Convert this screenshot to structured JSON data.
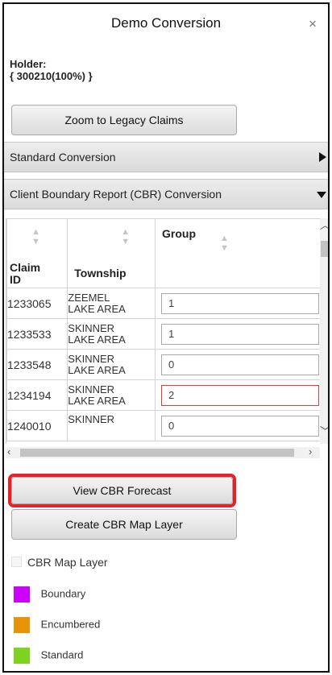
{
  "dialog": {
    "title": "Demo Conversion",
    "close_icon": "×"
  },
  "holder": {
    "label": "Holder:",
    "value": "{ 300210(100%) }"
  },
  "buttons": {
    "zoom_legacy": "Zoom to Legacy Claims",
    "view_cbr": "View CBR Forecast",
    "create_cbr_layer": "Create CBR Map Layer"
  },
  "accordion": {
    "standard": "Standard Conversion",
    "cbr": "Client Boundary Report (CBR) Conversion"
  },
  "table": {
    "headers": {
      "claim_id_line1": "Claim",
      "claim_id_line2": "ID",
      "township": "Township",
      "group": "Group"
    },
    "rows": [
      {
        "claim_id": "1233065",
        "township_line1": "ZEEMEL",
        "township_line2": "LAKE AREA",
        "group": "1"
      },
      {
        "claim_id": "1233533",
        "township_line1": "SKINNER",
        "township_line2": "LAKE AREA",
        "group": "1"
      },
      {
        "claim_id": "1233548",
        "township_line1": "SKINNER",
        "township_line2": "LAKE AREA",
        "group": "0"
      },
      {
        "claim_id": "1234194",
        "township_line1": "SKINNER",
        "township_line2": "LAKE AREA",
        "group": "2"
      },
      {
        "claim_id": "1240010",
        "township_line1": "SKINNER",
        "township_line2": "",
        "group": "0"
      }
    ]
  },
  "layer": {
    "checkbox_label": "CBR Map Layer"
  },
  "legend": [
    {
      "label": "Boundary",
      "color": "#cc00ff"
    },
    {
      "label": "Encumbered",
      "color": "#e8940a"
    },
    {
      "label": "Standard",
      "color": "#7ed321"
    }
  ]
}
